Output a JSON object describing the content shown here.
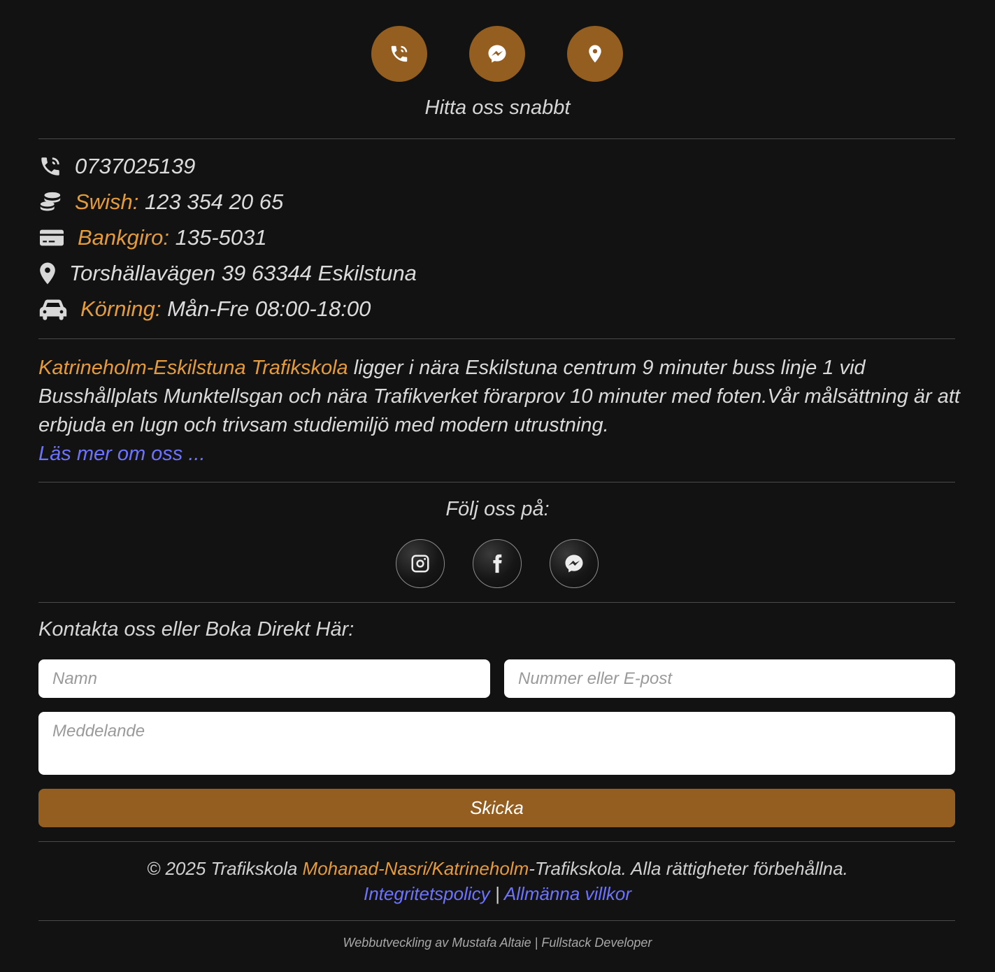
{
  "quick_contact": {
    "caption": "Hitta oss snabbt",
    "buttons": [
      {
        "icon": "phone-icon"
      },
      {
        "icon": "messenger-icon"
      },
      {
        "icon": "map-marker-icon"
      }
    ]
  },
  "info": {
    "phone": "0737025139",
    "swish_label": "Swish:",
    "swish_value": "123 354 20 65",
    "bankgiro_label": "Bankgiro:",
    "bankgiro_value": "135-5031",
    "address": "Torshällavägen 39 63344 Eskilstuna",
    "driving_label": "Körning:",
    "driving_value": "Mån-Fre 08:00-18:00"
  },
  "about": {
    "brand": "Katrineholm-Eskilstuna Trafikskola",
    "text": " ligger i nära Eskilstuna centrum 9 minuter buss linje 1 vid Busshållplats Munktellsgan och nära Trafikverket förarprov 10 minuter med foten.Vår målsättning är att erbjuda en lugn och trivsam studiemiljö med modern utrustning.",
    "read_more": "Läs mer om oss ..."
  },
  "social": {
    "title": "Följ oss på:",
    "buttons": [
      {
        "icon": "instagram-icon"
      },
      {
        "icon": "facebook-icon"
      },
      {
        "icon": "messenger-icon"
      }
    ]
  },
  "contact_form": {
    "title": "Kontakta oss eller Boka Direkt Här:",
    "name_placeholder": "Namn",
    "contact_placeholder": "Nummer eller E-post",
    "message_placeholder": "Meddelande",
    "submit_label": "Skicka"
  },
  "footer": {
    "copyright_prefix": "© 2025 Trafikskola ",
    "copyright_brand": "Mohanad-Nasri/Katrineholm",
    "copyright_suffix": "-Trafikskola. Alla rättigheter förbehållna.",
    "privacy_link": "Integritetspolicy",
    "separator": "|",
    "terms_link": "Allmänna villkor",
    "credit": "Webbutveckling av Mustafa Altaie | Fullstack Developer"
  },
  "colors": {
    "background": "#121212",
    "accent_brown": "#935e20",
    "accent_orange": "#e69b3a",
    "link_blue": "#6e73ff"
  }
}
